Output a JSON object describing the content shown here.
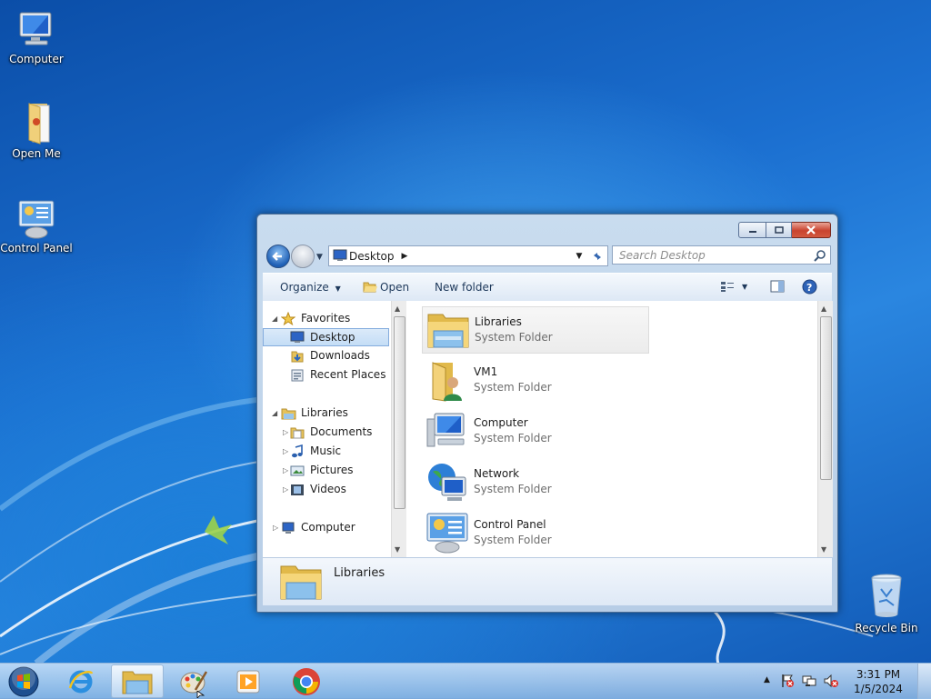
{
  "desktop": {
    "icons": [
      {
        "label": "Computer"
      },
      {
        "label": "Open Me"
      },
      {
        "label": "Control Panel"
      },
      {
        "label": "Recycle Bin"
      }
    ]
  },
  "explorer": {
    "address": {
      "crumb": "Desktop"
    },
    "search": {
      "placeholder": "Search Desktop"
    },
    "toolbar": {
      "organize": "Organize",
      "open": "Open",
      "new_folder": "New folder"
    },
    "nav": {
      "favorites": "Favorites",
      "desktop": "Desktop",
      "downloads": "Downloads",
      "recent_places": "Recent Places",
      "libraries": "Libraries",
      "documents": "Documents",
      "music": "Music",
      "pictures": "Pictures",
      "videos": "Videos",
      "computer": "Computer"
    },
    "files": [
      {
        "name": "Libraries",
        "type": "System Folder"
      },
      {
        "name": "VM1",
        "type": "System Folder"
      },
      {
        "name": "Computer",
        "type": "System Folder"
      },
      {
        "name": "Network",
        "type": "System Folder"
      },
      {
        "name": "Control Panel",
        "type": "System Folder"
      }
    ],
    "details": {
      "name": "Libraries"
    }
  },
  "taskbar": {
    "clock": {
      "time": "3:31 PM",
      "date": "1/5/2024"
    }
  }
}
